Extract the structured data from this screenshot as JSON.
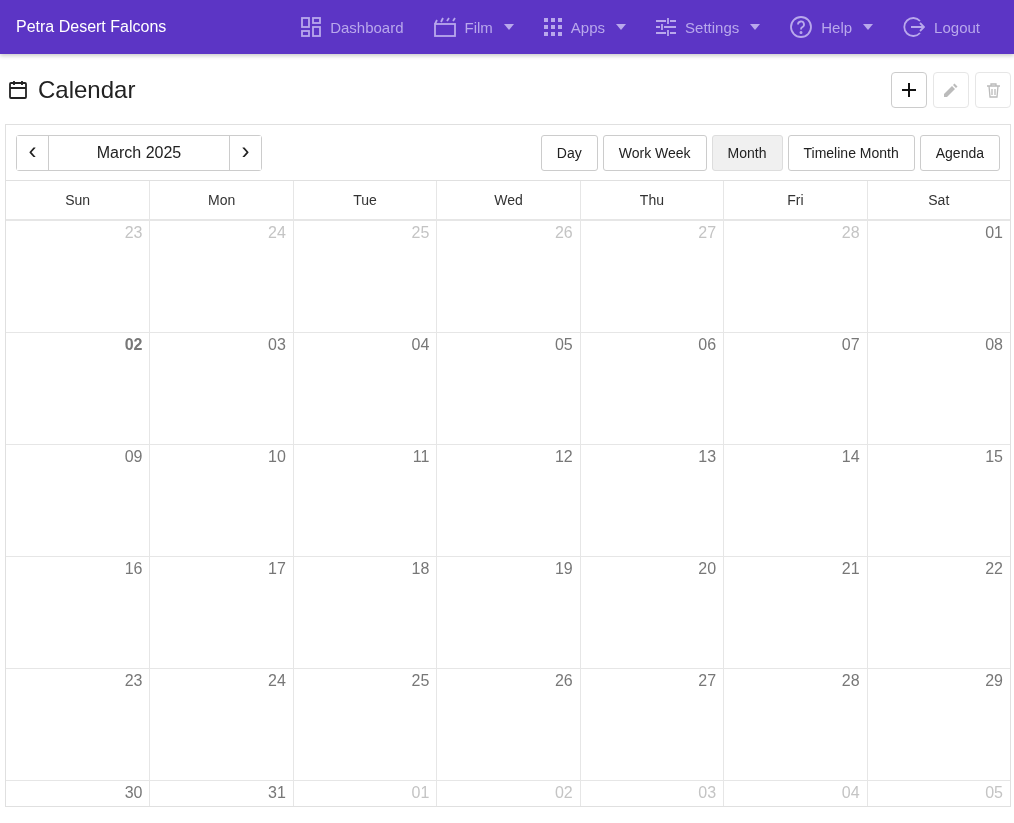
{
  "app_bar": {
    "title": "Petra Desert Falcons",
    "nav": [
      {
        "kind": "dashboard",
        "label": "Dashboard",
        "dropdown": false
      },
      {
        "kind": "film",
        "label": "Film",
        "dropdown": true
      },
      {
        "kind": "apps",
        "label": "Apps",
        "dropdown": true
      },
      {
        "kind": "settings",
        "label": "Settings",
        "dropdown": true
      },
      {
        "kind": "help",
        "label": "Help",
        "dropdown": true
      },
      {
        "kind": "logout",
        "label": "Logout",
        "dropdown": false
      }
    ]
  },
  "page": {
    "title": "Calendar",
    "actions": [
      {
        "kind": "add",
        "disabled": false
      },
      {
        "kind": "edit",
        "disabled": true
      },
      {
        "kind": "delete",
        "disabled": true
      }
    ]
  },
  "toolbar": {
    "prev": "‹",
    "date": "March 2025",
    "next": "›",
    "views": [
      {
        "label": "Day",
        "selected": false
      },
      {
        "label": "Work Week",
        "selected": false
      },
      {
        "label": "Month",
        "selected": true
      },
      {
        "label": "Timeline Month",
        "selected": false
      },
      {
        "label": "Agenda",
        "selected": false
      }
    ]
  },
  "weekdays": [
    "Sun",
    "Mon",
    "Tue",
    "Wed",
    "Thu",
    "Fri",
    "Sat"
  ],
  "weeks": [
    [
      {
        "day": "23",
        "other_month": true,
        "today": false
      },
      {
        "day": "24",
        "other_month": true,
        "today": false
      },
      {
        "day": "25",
        "other_month": true,
        "today": false
      },
      {
        "day": "26",
        "other_month": true,
        "today": false
      },
      {
        "day": "27",
        "other_month": true,
        "today": false
      },
      {
        "day": "28",
        "other_month": true,
        "today": false
      },
      {
        "day": "01",
        "other_month": false,
        "today": false
      }
    ],
    [
      {
        "day": "02",
        "other_month": false,
        "today": true
      },
      {
        "day": "03",
        "other_month": false,
        "today": false
      },
      {
        "day": "04",
        "other_month": false,
        "today": false
      },
      {
        "day": "05",
        "other_month": false,
        "today": false
      },
      {
        "day": "06",
        "other_month": false,
        "today": false
      },
      {
        "day": "07",
        "other_month": false,
        "today": false
      },
      {
        "day": "08",
        "other_month": false,
        "today": false
      }
    ],
    [
      {
        "day": "09",
        "other_month": false,
        "today": false
      },
      {
        "day": "10",
        "other_month": false,
        "today": false
      },
      {
        "day": "11",
        "other_month": false,
        "today": false
      },
      {
        "day": "12",
        "other_month": false,
        "today": false
      },
      {
        "day": "13",
        "other_month": false,
        "today": false
      },
      {
        "day": "14",
        "other_month": false,
        "today": false
      },
      {
        "day": "15",
        "other_month": false,
        "today": false
      }
    ],
    [
      {
        "day": "16",
        "other_month": false,
        "today": false
      },
      {
        "day": "17",
        "other_month": false,
        "today": false
      },
      {
        "day": "18",
        "other_month": false,
        "today": false
      },
      {
        "day": "19",
        "other_month": false,
        "today": false
      },
      {
        "day": "20",
        "other_month": false,
        "today": false
      },
      {
        "day": "21",
        "other_month": false,
        "today": false
      },
      {
        "day": "22",
        "other_month": false,
        "today": false
      }
    ],
    [
      {
        "day": "23",
        "other_month": false,
        "today": false
      },
      {
        "day": "24",
        "other_month": false,
        "today": false
      },
      {
        "day": "25",
        "other_month": false,
        "today": false
      },
      {
        "day": "26",
        "other_month": false,
        "today": false
      },
      {
        "day": "27",
        "other_month": false,
        "today": false
      },
      {
        "day": "28",
        "other_month": false,
        "today": false
      },
      {
        "day": "29",
        "other_month": false,
        "today": false
      }
    ],
    [
      {
        "day": "30",
        "other_month": false,
        "today": false
      },
      {
        "day": "31",
        "other_month": false,
        "today": false
      },
      {
        "day": "01",
        "other_month": true,
        "today": false
      },
      {
        "day": "02",
        "other_month": true,
        "today": false
      },
      {
        "day": "03",
        "other_month": true,
        "today": false
      },
      {
        "day": "04",
        "other_month": true,
        "today": false
      },
      {
        "day": "05",
        "other_month": true,
        "today": false
      }
    ]
  ]
}
